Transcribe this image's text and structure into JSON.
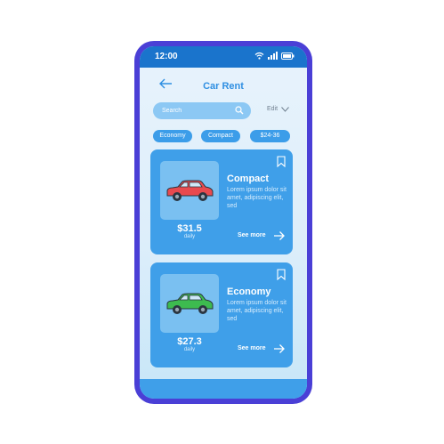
{
  "status_bar": {
    "time": "12:00"
  },
  "header": {
    "title": "Car Rent"
  },
  "search": {
    "placeholder": "Search"
  },
  "edit_label": "Edit",
  "filters": [
    "Economy",
    "Compact",
    "$24-36"
  ],
  "cars": [
    {
      "name": "Compact",
      "description": "Lorem ipsum dolor sit amet, adipiscing elit, sed",
      "price": "$31.5",
      "period": "daily",
      "see_more": "See more",
      "car_color": "#e84a4f"
    },
    {
      "name": "Economy",
      "description": "Lorem ipsum dolor sit amet, adipiscing elit, sed",
      "price": "$27.3",
      "period": "daily",
      "see_more": "See more",
      "car_color": "#3dbb4f"
    }
  ],
  "colors": {
    "accent": "#3f9fe9",
    "frame": "#4a3fd6",
    "status_bar": "#1a74cc"
  },
  "icons": [
    "wifi-icon",
    "signal-icon",
    "battery-icon",
    "back-arrow-icon",
    "search-icon",
    "chevron-down-icon",
    "bookmark-icon",
    "arrow-right-icon"
  ]
}
